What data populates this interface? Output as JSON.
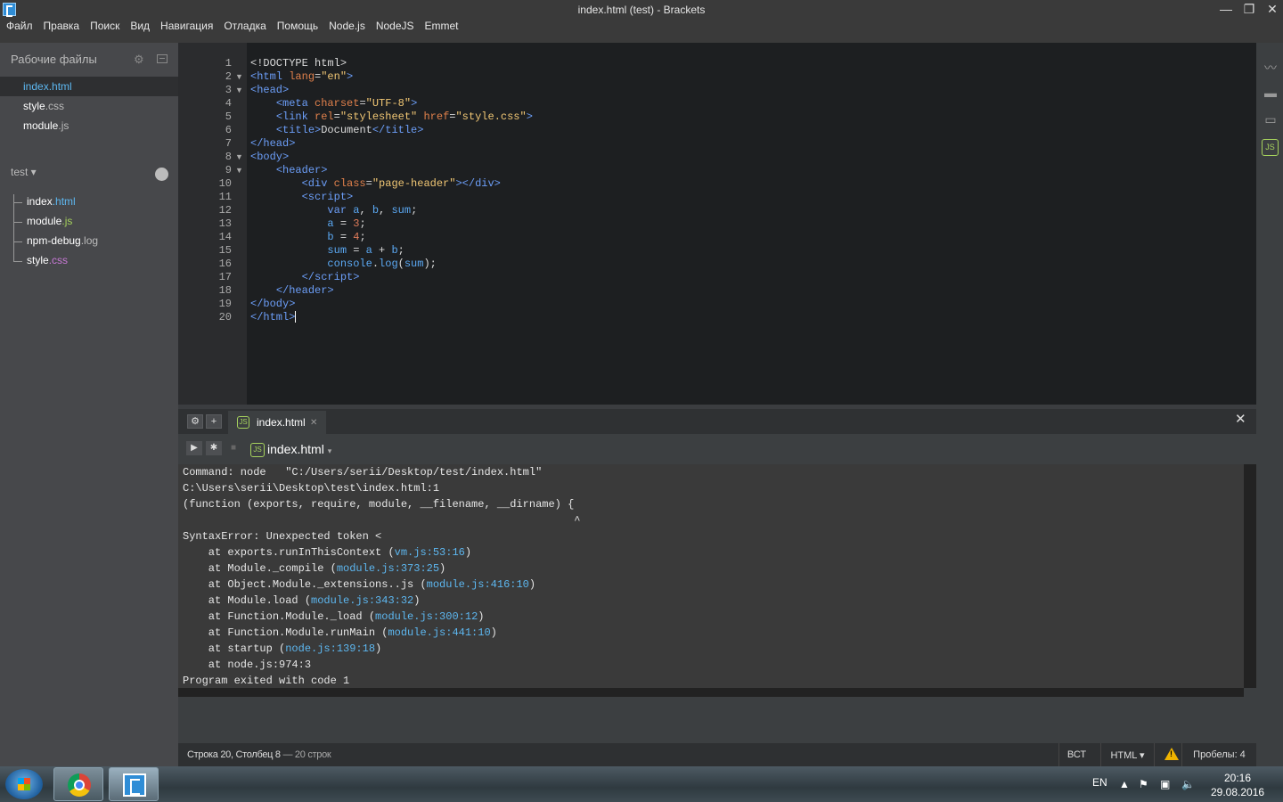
{
  "window": {
    "title": "index.html (test) - Brackets",
    "minimize": "—",
    "restore": "❐",
    "close": "✕"
  },
  "menu": [
    "Файл",
    "Правка",
    "Поиск",
    "Вид",
    "Навигация",
    "Отладка",
    "Помощь",
    "Node.js",
    "NodeJS",
    "Emmet"
  ],
  "sidebar": {
    "working_title": "Рабочие файлы",
    "working_files": [
      {
        "name": "index.html",
        "ext": ""
      },
      {
        "name": "style",
        "ext": ".css"
      },
      {
        "name": "module",
        "ext": ".js"
      }
    ],
    "project_title": "test ▾",
    "tree": [
      {
        "name": "index",
        "ext": ".html"
      },
      {
        "name": "module",
        "ext": ".js"
      },
      {
        "name": "npm-debug",
        "ext": ".log"
      },
      {
        "name": "style",
        "ext": ".css"
      }
    ]
  },
  "editor": {
    "line_numbers": [
      "1",
      "2",
      "3",
      "4",
      "5",
      "6",
      "7",
      "8",
      "9",
      "10",
      "11",
      "12",
      "13",
      "14",
      "15",
      "16",
      "17",
      "18",
      "19",
      "20"
    ]
  },
  "panel": {
    "tab_label": "index.html",
    "run_file": "index.html",
    "console": {
      "command": "Command: node   \"C:/Users/serii/Desktop/test/index.html\"",
      "line2": "C:\\Users\\serii\\Desktop\\test\\index.html:1",
      "line3": "(function (exports, require, module, __filename, __dirname) {",
      "caret": "                                                             ^",
      "error": "SyntaxError: Unexpected token <",
      "stack": [
        {
          "text": "    at exports.runInThisContext (",
          "link": "vm.js:53:16",
          "end": ")"
        },
        {
          "text": "    at Module._compile (",
          "link": "module.js:373:25",
          "end": ")"
        },
        {
          "text": "    at Object.Module._extensions..js (",
          "link": "module.js:416:10",
          "end": ")"
        },
        {
          "text": "    at Module.load (",
          "link": "module.js:343:32",
          "end": ")"
        },
        {
          "text": "    at Function.Module._load (",
          "link": "module.js:300:12",
          "end": ")"
        },
        {
          "text": "    at Function.Module.runMain (",
          "link": "module.js:441:10",
          "end": ")"
        },
        {
          "text": "    at startup (",
          "link": "node.js:139:18",
          "end": ")"
        },
        {
          "text": "    at node.js:974:3",
          "link": "",
          "end": ""
        }
      ],
      "exit": "Program exited with code 1"
    }
  },
  "status": {
    "position": "Строка 20, Столбец 8",
    "lines": " — 20 строк",
    "mode": "ВСТ",
    "language": "HTML ▾",
    "indent": "Пробелы: 4"
  },
  "taskbar": {
    "lang": "EN",
    "time": "20:16",
    "date": "29.08.2016"
  }
}
